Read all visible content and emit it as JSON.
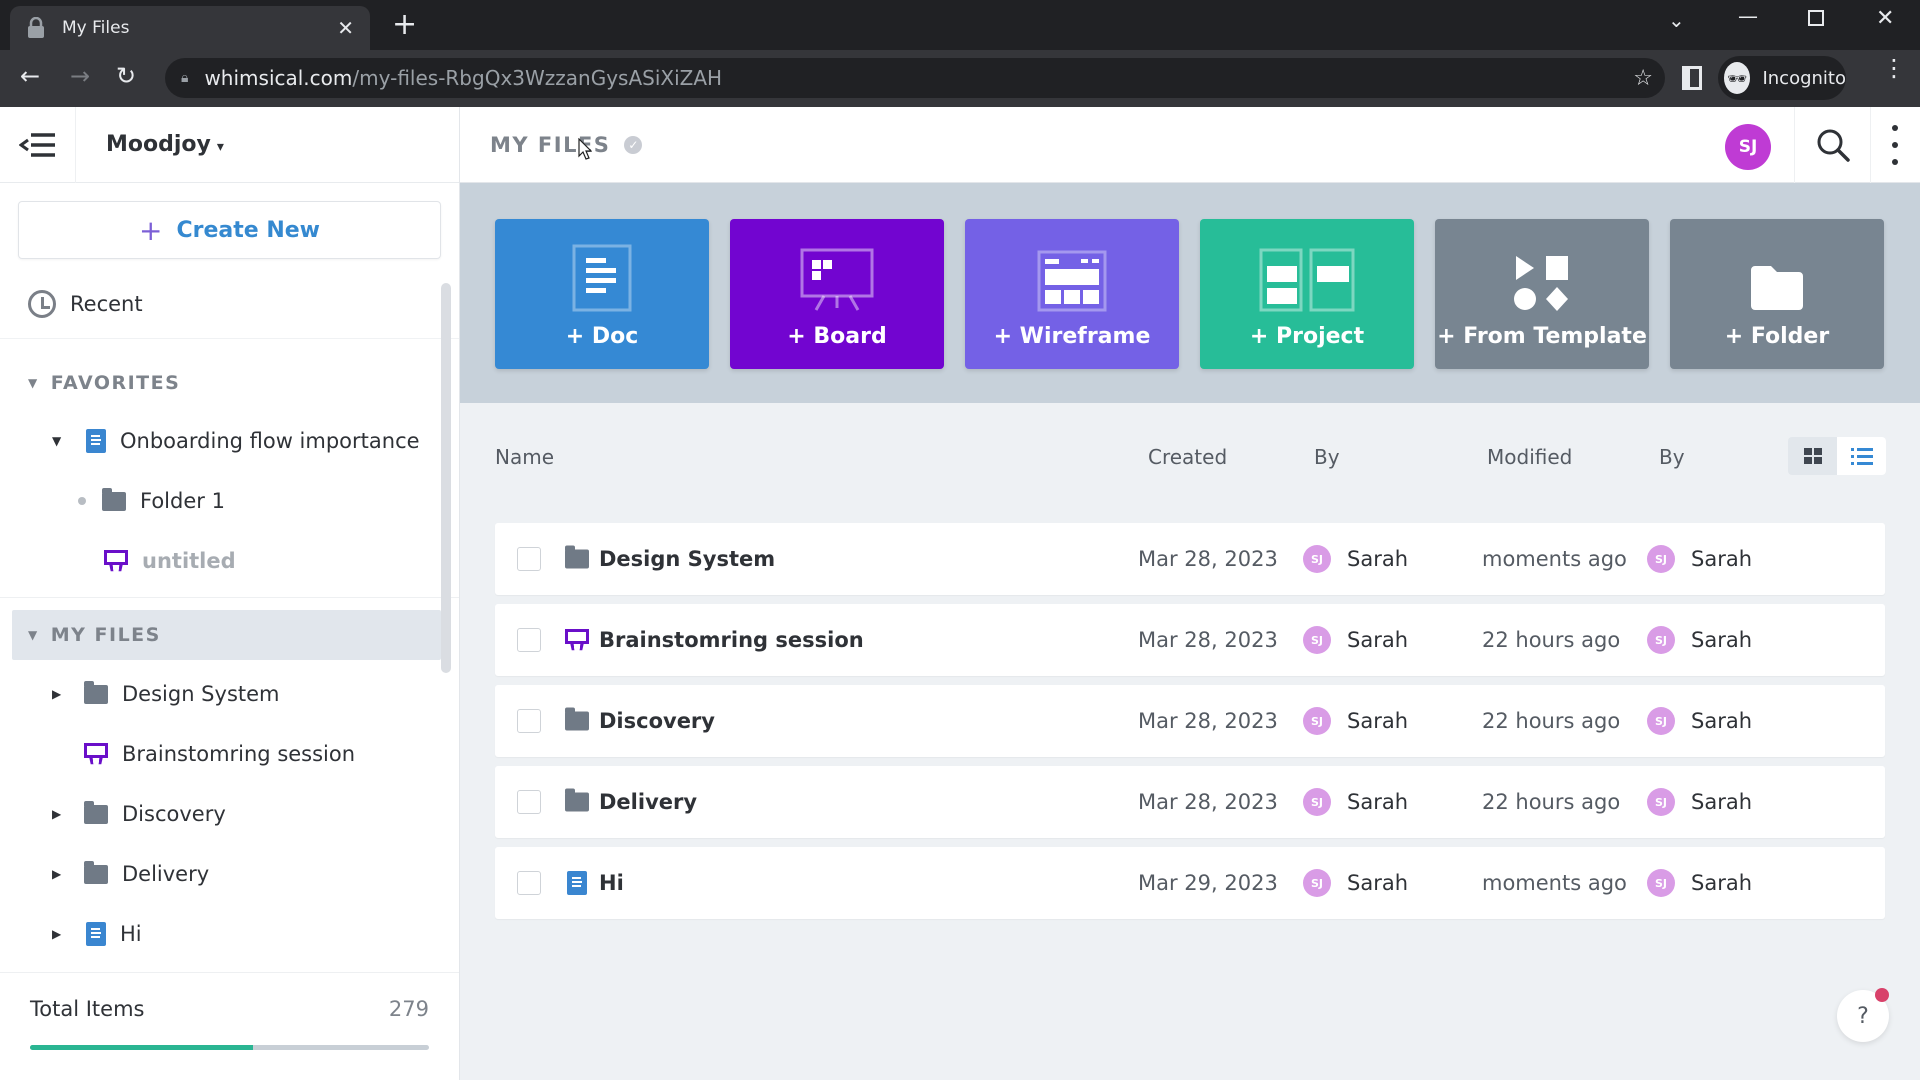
{
  "browser": {
    "tab_title": "My Files",
    "url_host": "whimsical.com",
    "url_path": "/my-files-RbgQx3WzzanGysASiXiZAH",
    "profile_label": "Incognito"
  },
  "sidebar": {
    "workspace": "Moodjoy",
    "create_new_label": "Create New",
    "recent_label": "Recent",
    "favorites": {
      "label": "FAVORITES",
      "items": [
        {
          "label": "Onboarding flow importance",
          "type": "doc",
          "depth": 0,
          "expanded": true
        },
        {
          "label": "Folder 1",
          "type": "folder",
          "depth": 1
        },
        {
          "label": "untitled",
          "type": "board",
          "depth": 1,
          "muted": true
        }
      ]
    },
    "my_files": {
      "label": "MY FILES",
      "items": [
        {
          "label": "Design System",
          "type": "folder",
          "expandable": true
        },
        {
          "label": "Brainstomring session",
          "type": "board",
          "expandable": false
        },
        {
          "label": "Discovery",
          "type": "folder",
          "expandable": true
        },
        {
          "label": "Delivery",
          "type": "folder",
          "expandable": true
        },
        {
          "label": "Hi",
          "type": "doc",
          "expandable": true
        }
      ]
    },
    "footer": {
      "total_label": "Total Items",
      "total_value": "279",
      "usage_fraction": 0.56
    }
  },
  "header": {
    "breadcrumb": "MY FILES",
    "user_initials": "SJ"
  },
  "create_tiles": [
    {
      "label": "+ Doc",
      "color": "#3589d4"
    },
    {
      "label": "+ Board",
      "color": "#7205d0"
    },
    {
      "label": "+ Wireframe",
      "color": "#7461e6"
    },
    {
      "label": "+ Project",
      "color": "#27bd98"
    },
    {
      "label": "+ From Template",
      "color": "#788591"
    },
    {
      "label": "+ Folder",
      "color": "#788591"
    }
  ],
  "table": {
    "columns": [
      "Name",
      "Created",
      "By",
      "Modified",
      "By"
    ],
    "rows": [
      {
        "name": "Design System",
        "type": "folder",
        "created": "Mar 28, 2023",
        "created_by": "Sarah",
        "created_by_initials": "SJ",
        "modified": "moments ago",
        "modified_by": "Sarah",
        "modified_by_initials": "SJ"
      },
      {
        "name": "Brainstomring session",
        "type": "board",
        "created": "Mar 28, 2023",
        "created_by": "Sarah",
        "created_by_initials": "SJ",
        "modified": "22 hours ago",
        "modified_by": "Sarah",
        "modified_by_initials": "SJ"
      },
      {
        "name": "Discovery",
        "type": "folder",
        "created": "Mar 28, 2023",
        "created_by": "Sarah",
        "created_by_initials": "SJ",
        "modified": "22 hours ago",
        "modified_by": "Sarah",
        "modified_by_initials": "SJ"
      },
      {
        "name": "Delivery",
        "type": "folder",
        "created": "Mar 28, 2023",
        "created_by": "Sarah",
        "created_by_initials": "SJ",
        "modified": "22 hours ago",
        "modified_by": "Sarah",
        "modified_by_initials": "SJ"
      },
      {
        "name": "Hi",
        "type": "doc",
        "created": "Mar 29, 2023",
        "created_by": "Sarah",
        "created_by_initials": "SJ",
        "modified": "moments ago",
        "modified_by": "Sarah",
        "modified_by_initials": "SJ"
      }
    ]
  },
  "view_mode": "list",
  "help_label": "?"
}
